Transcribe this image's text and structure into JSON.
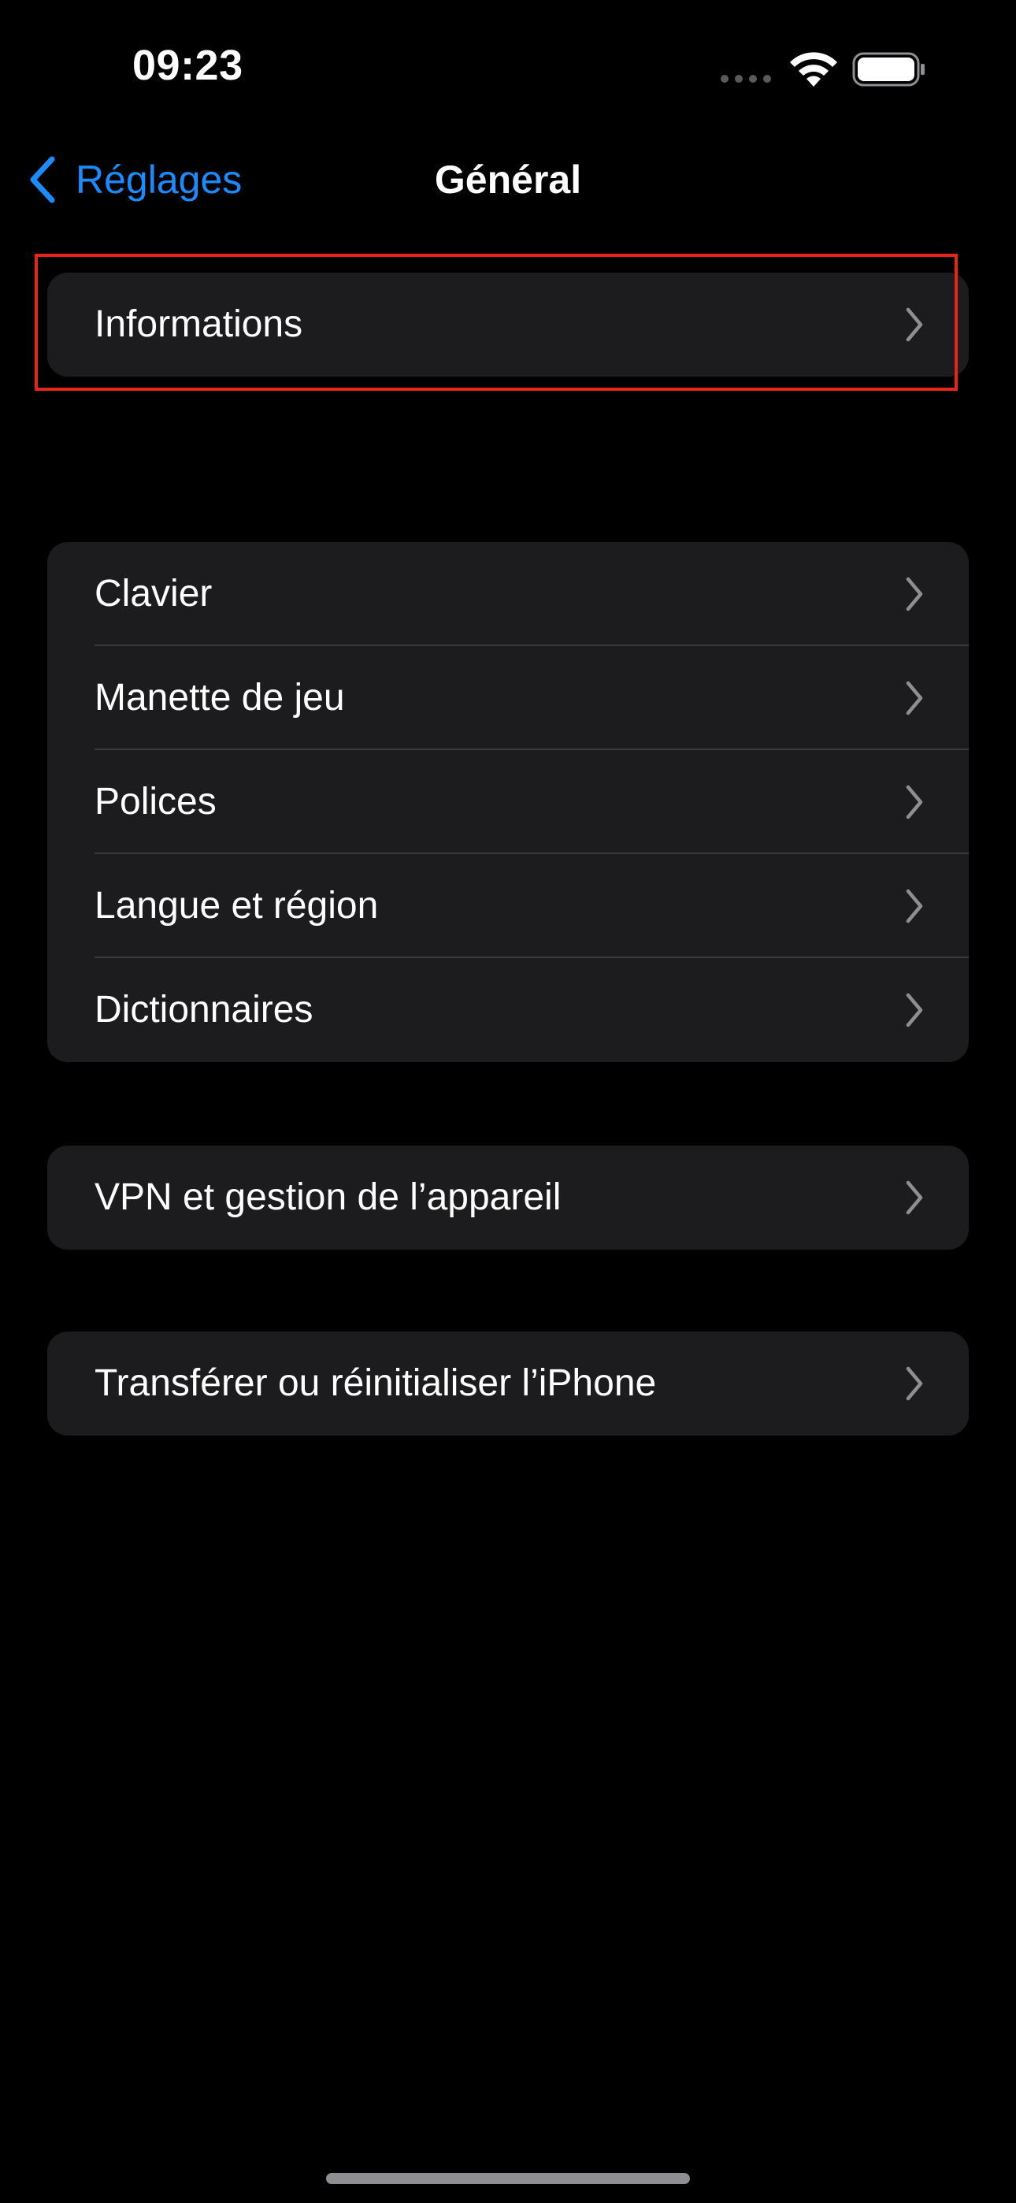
{
  "status_bar": {
    "time": "09:23"
  },
  "nav": {
    "back_label": "Réglages",
    "title": "Général"
  },
  "groups": {
    "info": {
      "items": [
        {
          "label": "Informations"
        }
      ]
    },
    "main": {
      "items": [
        {
          "label": "Clavier"
        },
        {
          "label": "Manette de jeu"
        },
        {
          "label": "Polices"
        },
        {
          "label": "Langue et région"
        },
        {
          "label": "Dictionnaires"
        }
      ]
    },
    "vpn": {
      "items": [
        {
          "label": "VPN et gestion de l’appareil"
        }
      ]
    },
    "reset": {
      "items": [
        {
          "label": "Transférer ou réinitialiser l’iPhone"
        }
      ]
    }
  },
  "colors": {
    "background": "#000000",
    "cell_background": "#1c1c1e",
    "accent": "#1a8cff",
    "highlight": "#e8251b",
    "chevron": "#8e8e93"
  },
  "icons": {
    "back": "chevron-left-icon",
    "row": "chevron-right-icon",
    "wifi": "wifi-icon",
    "battery": "battery-icon",
    "cellular": "cellular-dots-icon"
  }
}
